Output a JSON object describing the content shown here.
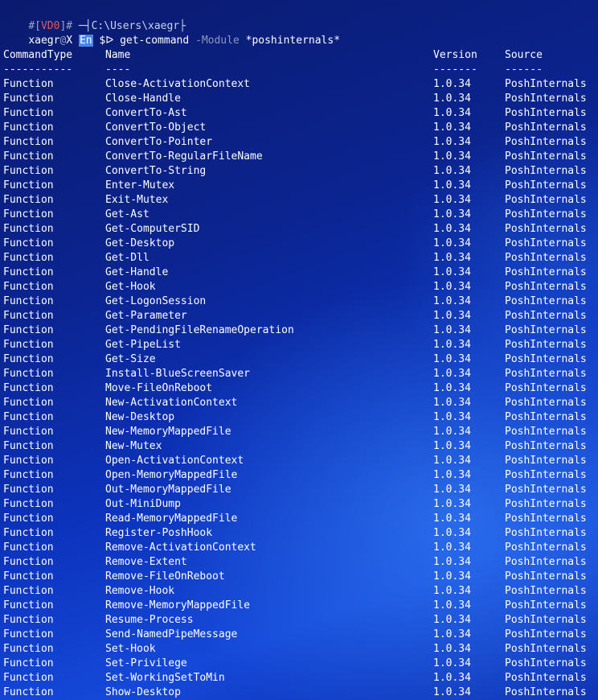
{
  "prompt": {
    "line1_hash": "#",
    "line1_bracket_open": "[",
    "line1_vd": "VD",
    "line1_zero": "0",
    "line1_bracket_close": "]",
    "line1_hash2": "#",
    "line1_path_prefix": " ─┤",
    "line1_path": "C:\\Users\\xaegr",
    "line1_path_suffix": "├",
    "user": "xaegr",
    "at": "@",
    "host": "X",
    "lang_badge": "En",
    "symbol": "$ᐅ",
    "command": "get-command",
    "param": "-Module",
    "argument": "*poshinternals*"
  },
  "table": {
    "headers": [
      "CommandType",
      "Name",
      "Version",
      "Source"
    ],
    "separators": [
      "-----------",
      "----",
      "-------",
      "------"
    ],
    "rows": [
      [
        "Function",
        "Close-ActivationContext",
        "1.0.34",
        "PoshInternals"
      ],
      [
        "Function",
        "Close-Handle",
        "1.0.34",
        "PoshInternals"
      ],
      [
        "Function",
        "ConvertTo-Ast",
        "1.0.34",
        "PoshInternals"
      ],
      [
        "Function",
        "ConvertTo-Object",
        "1.0.34",
        "PoshInternals"
      ],
      [
        "Function",
        "ConvertTo-Pointer",
        "1.0.34",
        "PoshInternals"
      ],
      [
        "Function",
        "ConvertTo-RegularFileName",
        "1.0.34",
        "PoshInternals"
      ],
      [
        "Function",
        "ConvertTo-String",
        "1.0.34",
        "PoshInternals"
      ],
      [
        "Function",
        "Enter-Mutex",
        "1.0.34",
        "PoshInternals"
      ],
      [
        "Function",
        "Exit-Mutex",
        "1.0.34",
        "PoshInternals"
      ],
      [
        "Function",
        "Get-Ast",
        "1.0.34",
        "PoshInternals"
      ],
      [
        "Function",
        "Get-ComputerSID",
        "1.0.34",
        "PoshInternals"
      ],
      [
        "Function",
        "Get-Desktop",
        "1.0.34",
        "PoshInternals"
      ],
      [
        "Function",
        "Get-Dll",
        "1.0.34",
        "PoshInternals"
      ],
      [
        "Function",
        "Get-Handle",
        "1.0.34",
        "PoshInternals"
      ],
      [
        "Function",
        "Get-Hook",
        "1.0.34",
        "PoshInternals"
      ],
      [
        "Function",
        "Get-LogonSession",
        "1.0.34",
        "PoshInternals"
      ],
      [
        "Function",
        "Get-Parameter",
        "1.0.34",
        "PoshInternals"
      ],
      [
        "Function",
        "Get-PendingFileRenameOperation",
        "1.0.34",
        "PoshInternals"
      ],
      [
        "Function",
        "Get-PipeList",
        "1.0.34",
        "PoshInternals"
      ],
      [
        "Function",
        "Get-Size",
        "1.0.34",
        "PoshInternals"
      ],
      [
        "Function",
        "Install-BlueScreenSaver",
        "1.0.34",
        "PoshInternals"
      ],
      [
        "Function",
        "Move-FileOnReboot",
        "1.0.34",
        "PoshInternals"
      ],
      [
        "Function",
        "New-ActivationContext",
        "1.0.34",
        "PoshInternals"
      ],
      [
        "Function",
        "New-Desktop",
        "1.0.34",
        "PoshInternals"
      ],
      [
        "Function",
        "New-MemoryMappedFile",
        "1.0.34",
        "PoshInternals"
      ],
      [
        "Function",
        "New-Mutex",
        "1.0.34",
        "PoshInternals"
      ],
      [
        "Function",
        "Open-ActivationContext",
        "1.0.34",
        "PoshInternals"
      ],
      [
        "Function",
        "Open-MemoryMappedFile",
        "1.0.34",
        "PoshInternals"
      ],
      [
        "Function",
        "Out-MemoryMappedFile",
        "1.0.34",
        "PoshInternals"
      ],
      [
        "Function",
        "Out-MiniDump",
        "1.0.34",
        "PoshInternals"
      ],
      [
        "Function",
        "Read-MemoryMappedFile",
        "1.0.34",
        "PoshInternals"
      ],
      [
        "Function",
        "Register-PoshHook",
        "1.0.34",
        "PoshInternals"
      ],
      [
        "Function",
        "Remove-ActivationContext",
        "1.0.34",
        "PoshInternals"
      ],
      [
        "Function",
        "Remove-Extent",
        "1.0.34",
        "PoshInternals"
      ],
      [
        "Function",
        "Remove-FileOnReboot",
        "1.0.34",
        "PoshInternals"
      ],
      [
        "Function",
        "Remove-Hook",
        "1.0.34",
        "PoshInternals"
      ],
      [
        "Function",
        "Remove-MemoryMappedFile",
        "1.0.34",
        "PoshInternals"
      ],
      [
        "Function",
        "Resume-Process",
        "1.0.34",
        "PoshInternals"
      ],
      [
        "Function",
        "Send-NamedPipeMessage",
        "1.0.34",
        "PoshInternals"
      ],
      [
        "Function",
        "Set-Hook",
        "1.0.34",
        "PoshInternals"
      ],
      [
        "Function",
        "Set-Privilege",
        "1.0.34",
        "PoshInternals"
      ],
      [
        "Function",
        "Set-WorkingSetToMin",
        "1.0.34",
        "PoshInternals"
      ],
      [
        "Function",
        "Show-Desktop",
        "1.0.34",
        "PoshInternals"
      ]
    ]
  },
  "colors": {
    "background_dark": "#0a1a6e",
    "background_light": "#1548d8",
    "text": "#ffffff",
    "prompt_dim": "#9aa3c8",
    "prompt_red": "#e05a5a",
    "badge": "#4a86e8"
  }
}
